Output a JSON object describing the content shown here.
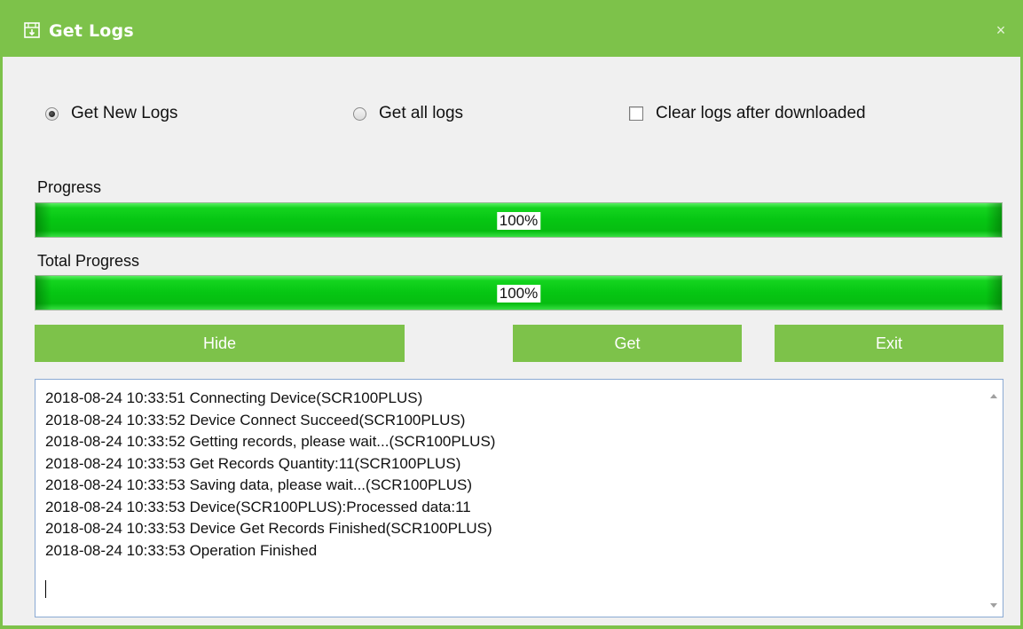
{
  "window": {
    "title": "Get Logs",
    "close_symbol": "×",
    "icon": "log-document-icon"
  },
  "options": {
    "get_new_logs": {
      "label": "Get New Logs",
      "selected": true
    },
    "get_all_logs": {
      "label": "Get all logs",
      "selected": false
    },
    "clear_logs": {
      "label": "Clear logs after downloaded",
      "checked": false
    }
  },
  "progress": {
    "label": "Progress",
    "value": 100,
    "text": "100%"
  },
  "total_progress": {
    "label": "Total Progress",
    "value": 100,
    "text": "100%"
  },
  "buttons": {
    "hide": "Hide",
    "get": "Get",
    "exit": "Exit"
  },
  "log": {
    "lines": [
      "2018-08-24 10:33:51 Connecting Device(SCR100PLUS)",
      "2018-08-24 10:33:52 Device Connect Succeed(SCR100PLUS)",
      "2018-08-24 10:33:52 Getting records, please wait...(SCR100PLUS)",
      "2018-08-24 10:33:53 Get Records Quantity:11(SCR100PLUS)",
      "2018-08-24 10:33:53 Saving data, please wait...(SCR100PLUS)",
      "2018-08-24 10:33:53 Device(SCR100PLUS):Processed data:11",
      "2018-08-24 10:33:53 Device Get Records Finished(SCR100PLUS)",
      "2018-08-24 10:33:53 Operation Finished"
    ]
  },
  "colors": {
    "accent": "#7dc24a",
    "progress_fill": "#06c613"
  }
}
